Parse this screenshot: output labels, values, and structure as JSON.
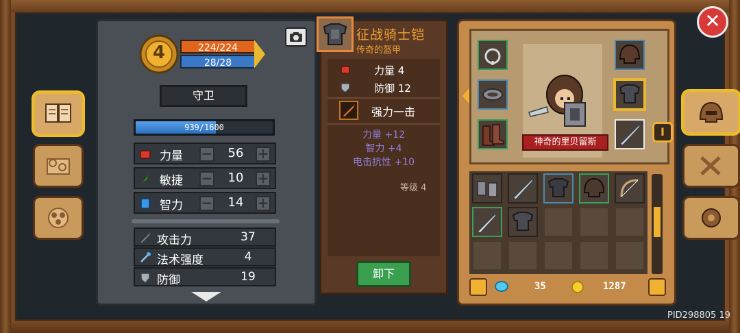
{
  "hero": {
    "level": "4",
    "hp": "224/224",
    "mp": "28/28",
    "class": "守卫",
    "xp": "939/1600",
    "xp_fraction": 0.587
  },
  "attributes": [
    {
      "label": "力量",
      "value": "56",
      "icon": "fist-icon"
    },
    {
      "label": "敏捷",
      "value": "10",
      "icon": "feather-icon"
    },
    {
      "label": "智力",
      "value": "14",
      "icon": "book-icon"
    }
  ],
  "attr_buttons": {
    "minus": "−",
    "plus": "+"
  },
  "stats": [
    {
      "label": "攻击力",
      "value": "37",
      "icon": "sword-icon"
    },
    {
      "label": "法术强度",
      "value": "4",
      "icon": "wand-icon"
    },
    {
      "label": "防御",
      "value": "19",
      "icon": "shield-icon"
    }
  ],
  "item": {
    "name": "征战骑士铠",
    "type": "传奇的盔甲",
    "lines": [
      {
        "label": "力量 4",
        "icon": "fist-icon"
      },
      {
        "label": "防御 12",
        "icon": "shield-icon"
      }
    ],
    "skill": "强力一击",
    "bonuses": [
      "力量 +12",
      "智力 +4",
      "电击抗性 +10"
    ],
    "level": "等级 4",
    "unequip": "卸下"
  },
  "character": {
    "name": "神奇的里贝留斯"
  },
  "tab_marker": "I",
  "currency": {
    "gems": "35",
    "coins": "1287"
  },
  "close": "✕",
  "footer": {
    "pid": "PID298805  19"
  },
  "colors": {
    "hp": "#e0661e",
    "mp": "#3a78c8",
    "item_name": "#f0a030",
    "bonus": "#8f7fd8",
    "accent": "#f0b030"
  }
}
